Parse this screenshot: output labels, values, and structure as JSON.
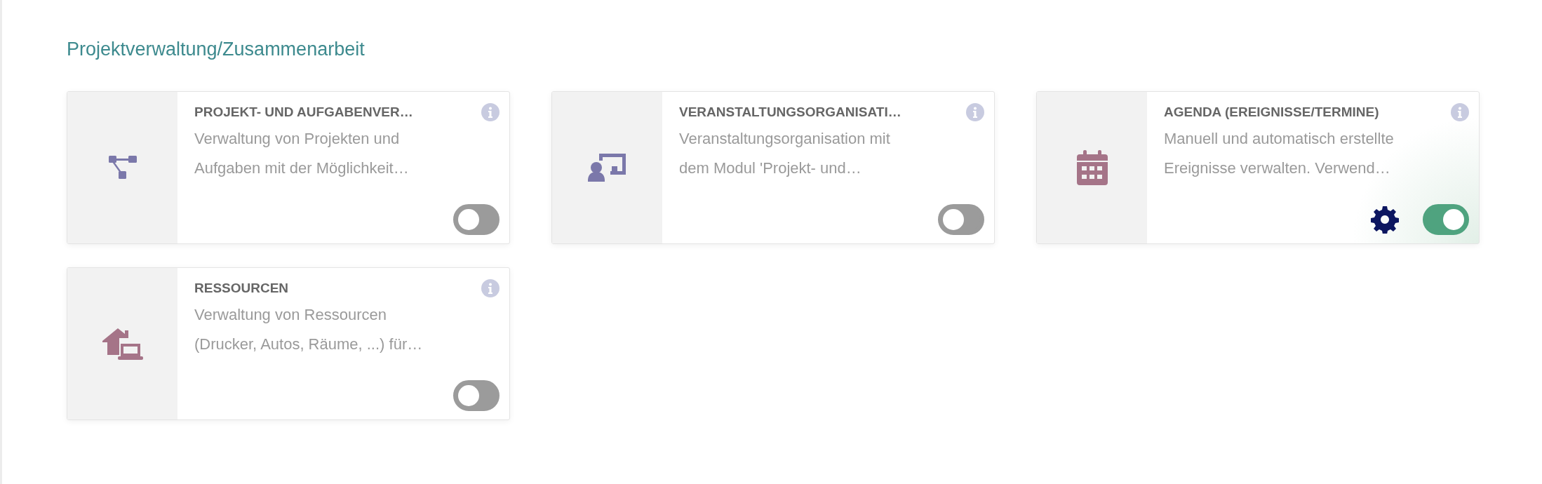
{
  "heading": "Projektverwaltung/Zusammenarbeit",
  "modules": [
    {
      "title": "PROJEKT- UND AUFGABENVER…",
      "lines": [
        "Verwaltung von Projekten und",
        "Aufgaben mit der Möglichkeit…"
      ],
      "kind": "hierarchy",
      "color": "#7b78aa",
      "on": false
    },
    {
      "title": "VERANSTALTUNGSORGANISATI…",
      "lines": [
        "Veranstaltungsorganisation mit",
        "dem Modul 'Projekt- und…"
      ],
      "kind": "presentation",
      "color": "#7b78aa",
      "on": false
    },
    {
      "title": "AGENDA (EREIGNISSE/TERMINE)",
      "lines": [
        "Manuell und automatisch erstellte",
        "Ereignisse verwalten. Verwend…"
      ],
      "kind": "calendar",
      "color": "#a57488",
      "on": true
    },
    {
      "title": "RESSOURCEN",
      "lines": [
        "Verwaltung von Ressourcen",
        "(Drucker, Autos, Räume, ...) für…"
      ],
      "kind": "resources",
      "color": "#a57488",
      "on": false
    }
  ]
}
